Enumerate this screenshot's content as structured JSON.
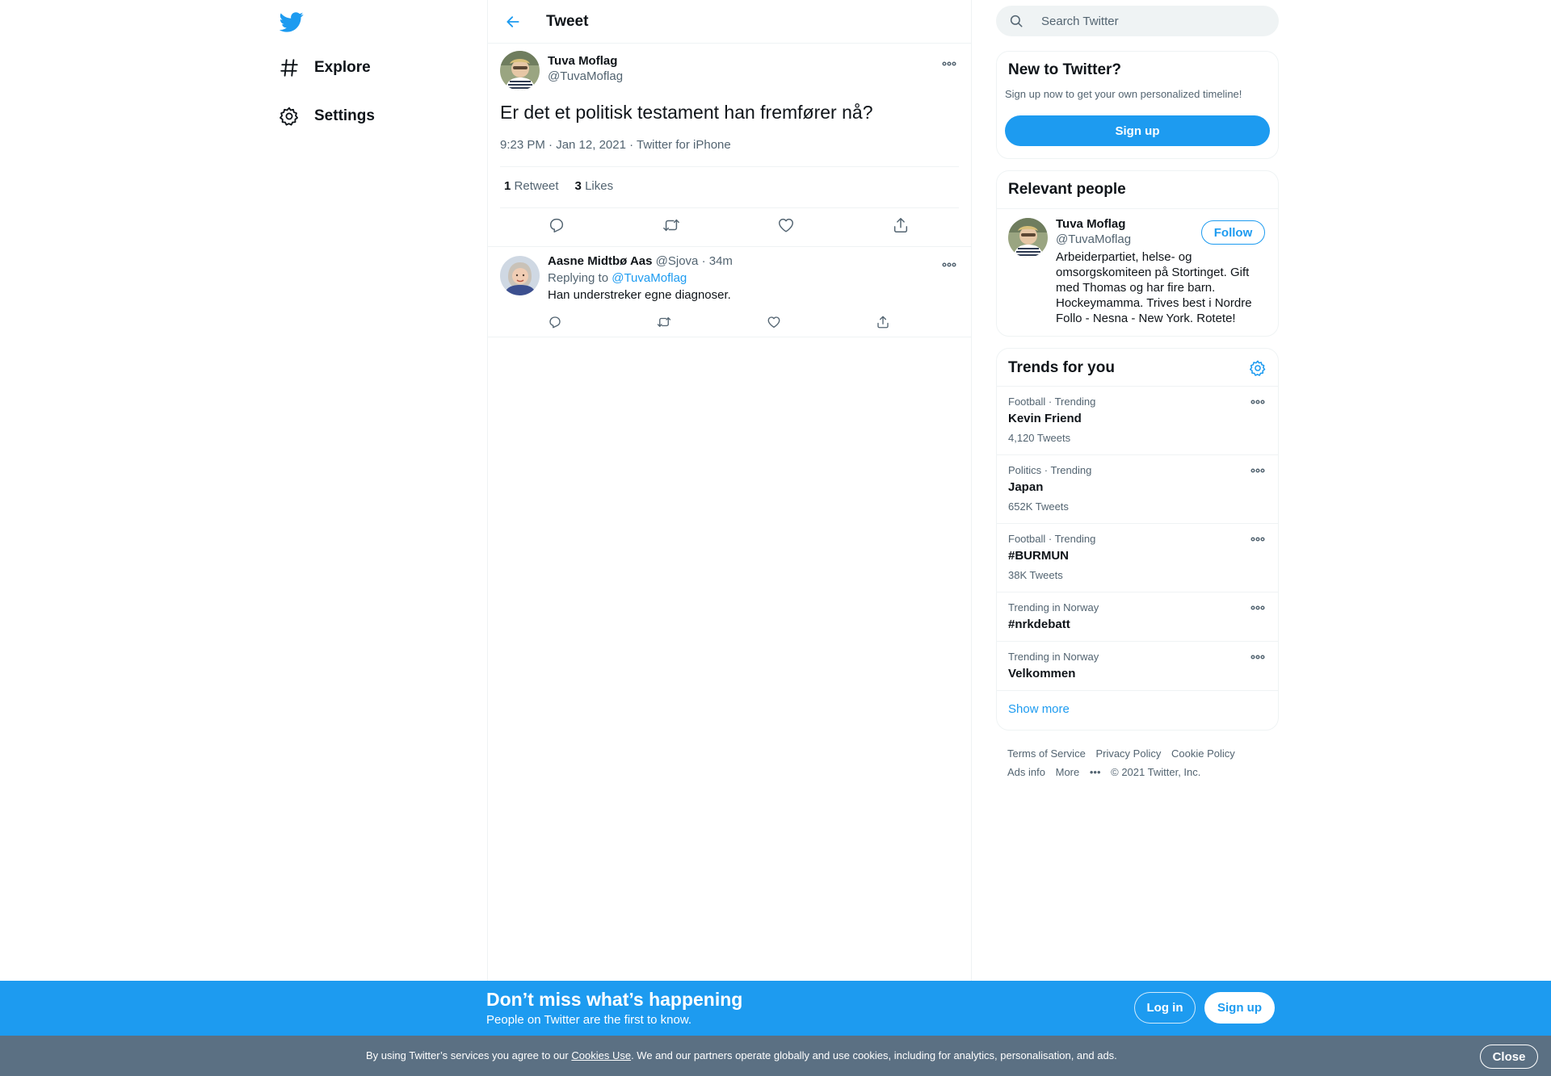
{
  "colors": {
    "accent": "#1d9bf0",
    "text": "#0f1419",
    "muted": "#536471",
    "border": "#eff3f4",
    "cookie_bg": "#5b7083"
  },
  "nav": {
    "logo_icon": "twitter-bird-icon",
    "items": [
      {
        "label": "Explore",
        "icon": "hashtag-icon"
      },
      {
        "label": "Settings",
        "icon": "gear-icon"
      }
    ]
  },
  "header": {
    "title": "Tweet"
  },
  "tweet": {
    "author_name": "Tuva Moflag",
    "author_handle": "@TuvaMoflag",
    "text": "Er det et politisk testament han fremfører nå?",
    "time": "9:23 PM · Jan 12, 2021",
    "sep": " · ",
    "source": "Twitter for iPhone",
    "retweets_count": "1",
    "retweets_label": "Retweet",
    "likes_count": "3",
    "likes_label": "Likes"
  },
  "reply": {
    "author_name": "Aasne Midtbø Aas",
    "author_handle": "@Sjova",
    "dot": "·",
    "time": "34m",
    "replying_to_label": "Replying to",
    "replying_to_handle": "@TuvaMoflag",
    "text": "Han understreker egne diagnoser."
  },
  "search": {
    "placeholder": "Search Twitter"
  },
  "new_panel": {
    "title": "New to Twitter?",
    "subtitle": "Sign up now to get your own personalized timeline!",
    "button": "Sign up"
  },
  "relevant": {
    "title": "Relevant people",
    "name": "Tuva Moflag",
    "handle": "@TuvaMoflag",
    "follow": "Follow",
    "bio": "Arbeiderpartiet, helse- og omsorgskomiteen på Stortinget. Gift med Thomas og har fire barn. Hockeymamma. Trives best i Nordre Follo - Nesna - New York. Rotete!"
  },
  "trends": {
    "title": "Trends for you",
    "items": [
      {
        "category": "Football · Trending",
        "title": "Kevin Friend",
        "count": "4,120 Tweets"
      },
      {
        "category": "Politics · Trending",
        "title": "Japan",
        "count": "652K Tweets"
      },
      {
        "category": "Football · Trending",
        "title": "#BURMUN",
        "count": "38K Tweets"
      },
      {
        "category": "Trending in Norway",
        "title": "#nrkdebatt",
        "count": ""
      },
      {
        "category": "Trending in Norway",
        "title": "Velkommen",
        "count": ""
      }
    ],
    "show_more": "Show more"
  },
  "footer": {
    "terms": "Terms of Service",
    "privacy": "Privacy Policy",
    "cookie": "Cookie Policy",
    "ads": "Ads info",
    "more": "More",
    "copyright": "© 2021 Twitter, Inc."
  },
  "signup_bar": {
    "heading": "Don’t miss what’s happening",
    "sub": "People on Twitter are the first to know.",
    "login": "Log in",
    "signup": "Sign up"
  },
  "cookie_bar": {
    "prefix": "By using Twitter’s services you agree to our ",
    "link": "Cookies Use",
    "suffix": ". We and our partners operate globally and use cookies, including for analytics, personalisation, and ads.",
    "close": "Close"
  }
}
